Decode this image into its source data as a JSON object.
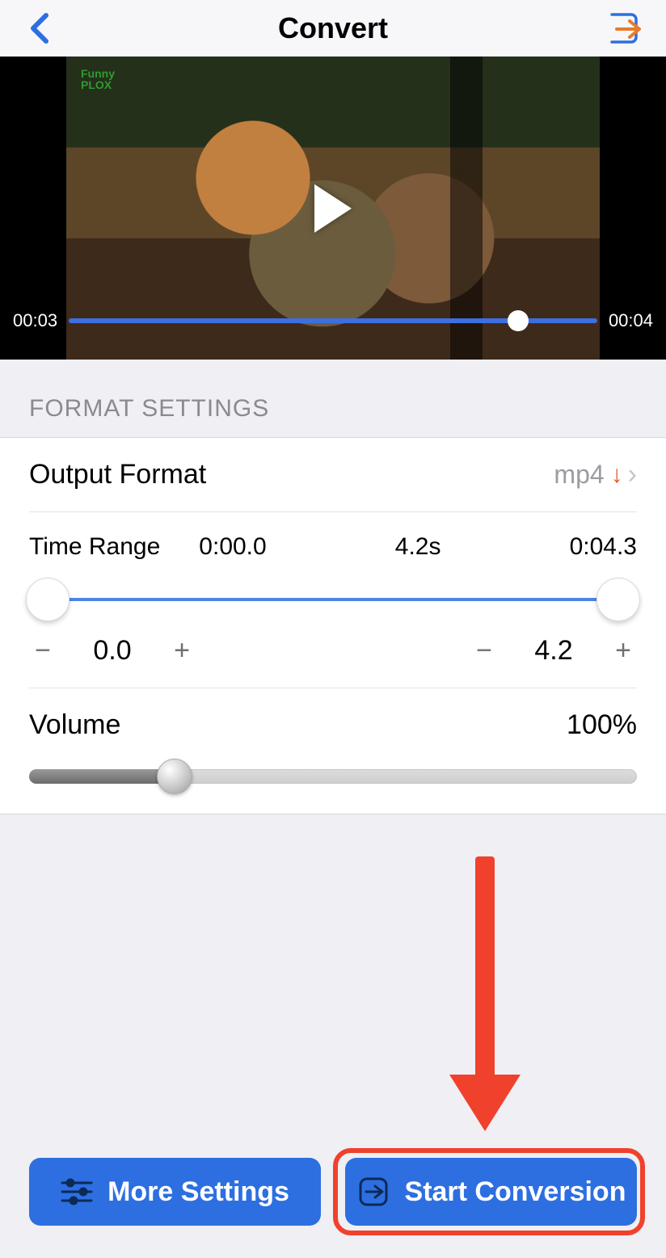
{
  "header": {
    "title": "Convert"
  },
  "video": {
    "current_time": "00:03",
    "total_time": "00:04",
    "scrub_percent": 85,
    "watermark_line1": "Funny",
    "watermark_line2": "PLOX"
  },
  "section_title": "FORMAT SETTINGS",
  "output_format": {
    "label": "Output Format",
    "value": "mp4"
  },
  "time_range": {
    "label": "Time Range",
    "start_display": "0:00.0",
    "duration_display": "4.2s",
    "end_display": "0:04.3",
    "start_value": "0.0",
    "end_value": "4.2",
    "slider_start_percent": 3,
    "slider_end_percent": 97
  },
  "volume": {
    "label": "Volume",
    "value_display": "100%",
    "slider_percent": 24
  },
  "buttons": {
    "more_settings": "More Settings",
    "start_conversion": "Start Conversion"
  }
}
